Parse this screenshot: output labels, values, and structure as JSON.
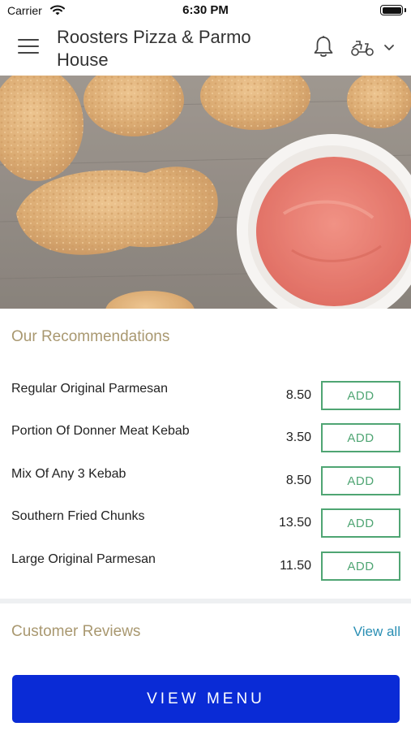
{
  "status_bar": {
    "carrier": "Carrier",
    "time": "6:30 PM",
    "icons": [
      "wifi-icon",
      "battery-icon"
    ]
  },
  "header": {
    "title": "Roosters Pizza & Parmo House",
    "icons": [
      "menu-icon",
      "bell-icon",
      "scooter-icon",
      "chevron-down-icon"
    ]
  },
  "hero": {
    "image_subject": "fried chicken pieces with a bowl of red sauce on a wooden table"
  },
  "recommendations": {
    "title": "Our Recommendations",
    "items": [
      {
        "name": "Regular Original Parmesan",
        "price": "8.50",
        "button": "ADD"
      },
      {
        "name": "Portion Of Donner Meat Kebab",
        "price": "3.50",
        "button": "ADD"
      },
      {
        "name": "Mix Of Any 3 Kebab",
        "price": "8.50",
        "button": "ADD"
      },
      {
        "name": "Southern Fried Chunks",
        "price": "13.50",
        "button": "ADD"
      },
      {
        "name": "Large Original Parmesan",
        "price": "11.50",
        "button": "ADD"
      }
    ]
  },
  "reviews": {
    "title": "Customer Reviews",
    "view_all": "View all"
  },
  "cta": {
    "label": "VIEW MENU"
  },
  "colors": {
    "accent_gold": "#a99870",
    "add_green": "#4fa573",
    "link_blue": "#2a8fb4",
    "cta_blue": "#0a2bd6"
  }
}
